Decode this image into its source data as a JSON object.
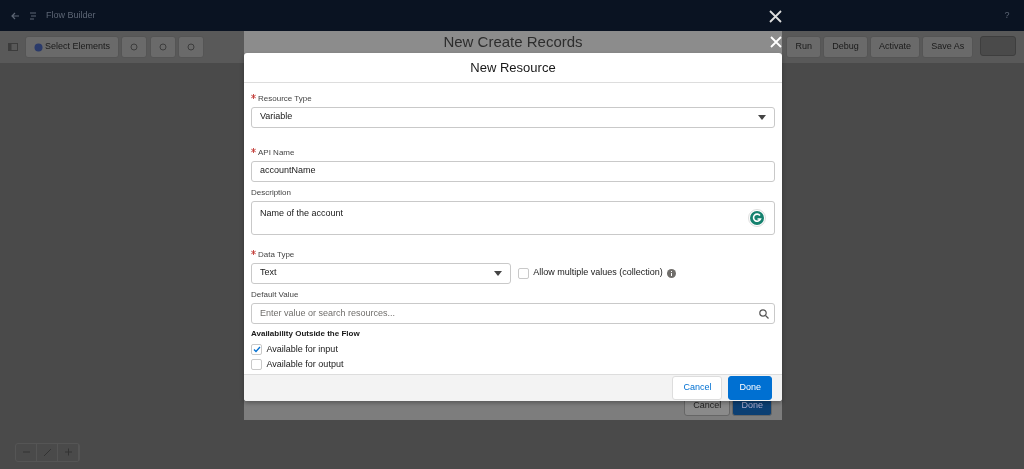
{
  "app_bar": {
    "title": "Flow Builder",
    "help": "?"
  },
  "toolbar": {
    "select_elements": "Select Elements",
    "buttons": [
      "Run",
      "Debug",
      "Activate",
      "Save As"
    ]
  },
  "background_modal": {
    "title": "New Create Records",
    "buttons": [
      "Cancel",
      "Done"
    ]
  },
  "modal": {
    "title": "New Resource",
    "fields": [
      {
        "kind": "select",
        "label": "Resource Type",
        "required": true,
        "value": "Variable"
      },
      {
        "kind": "input",
        "label": "API Name",
        "required": true,
        "value": "accountName"
      },
      {
        "kind": "textarea",
        "label": "Description",
        "required": false,
        "value": "Name of the account"
      }
    ],
    "data_type": {
      "label": "Data Type",
      "required": true,
      "value": "Text"
    },
    "allow_multiple": {
      "label": "Allow multiple values (collection)",
      "checked": false
    },
    "default_value": {
      "label": "Default Value",
      "placeholder": "Enter value or search resources..."
    },
    "availability": {
      "title": "Availability Outside the Flow",
      "options": [
        {
          "label": "Available for input",
          "checked": true
        },
        {
          "label": "Available for output",
          "checked": false
        }
      ]
    },
    "buttons": [
      "Cancel",
      "Done"
    ]
  }
}
